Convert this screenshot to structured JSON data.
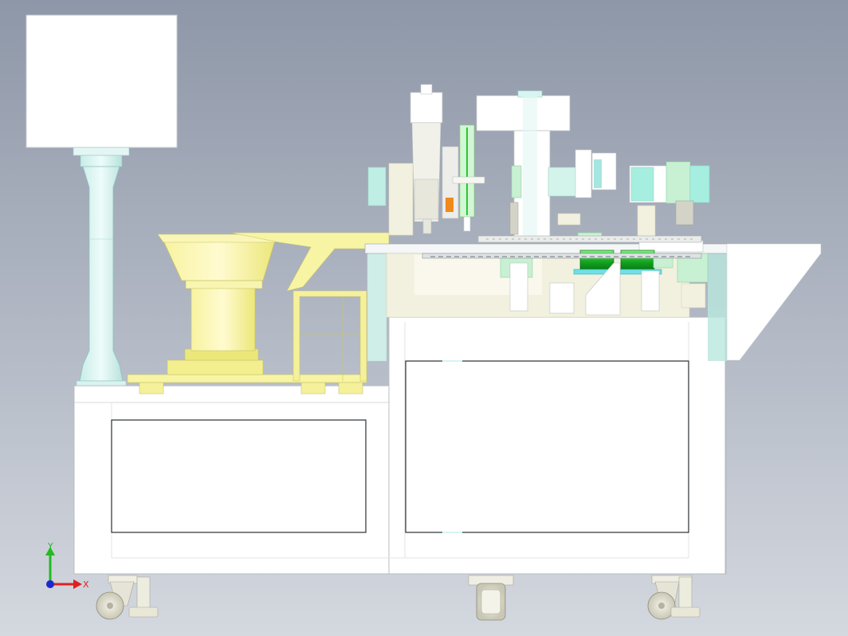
{
  "viewport": {
    "background_top": "#8e97a8",
    "background_bottom": "#d4d8df"
  },
  "triad": {
    "x_label": "X",
    "y_label": "Y",
    "x_color": "#e02020",
    "y_color": "#22bb22",
    "z_color": "#1a2ad0"
  },
  "colors": {
    "frame": "#ffffff",
    "outline": "#2a2f33",
    "feeder": "#f5f28a",
    "column": "#d6f5f2",
    "teal": "#a6ddd4",
    "mint": "#c8f0d2",
    "green": "#2ec43a",
    "cyan": "#6ee0e6",
    "orange": "#f08a1c",
    "cream": "#f2f1df"
  }
}
